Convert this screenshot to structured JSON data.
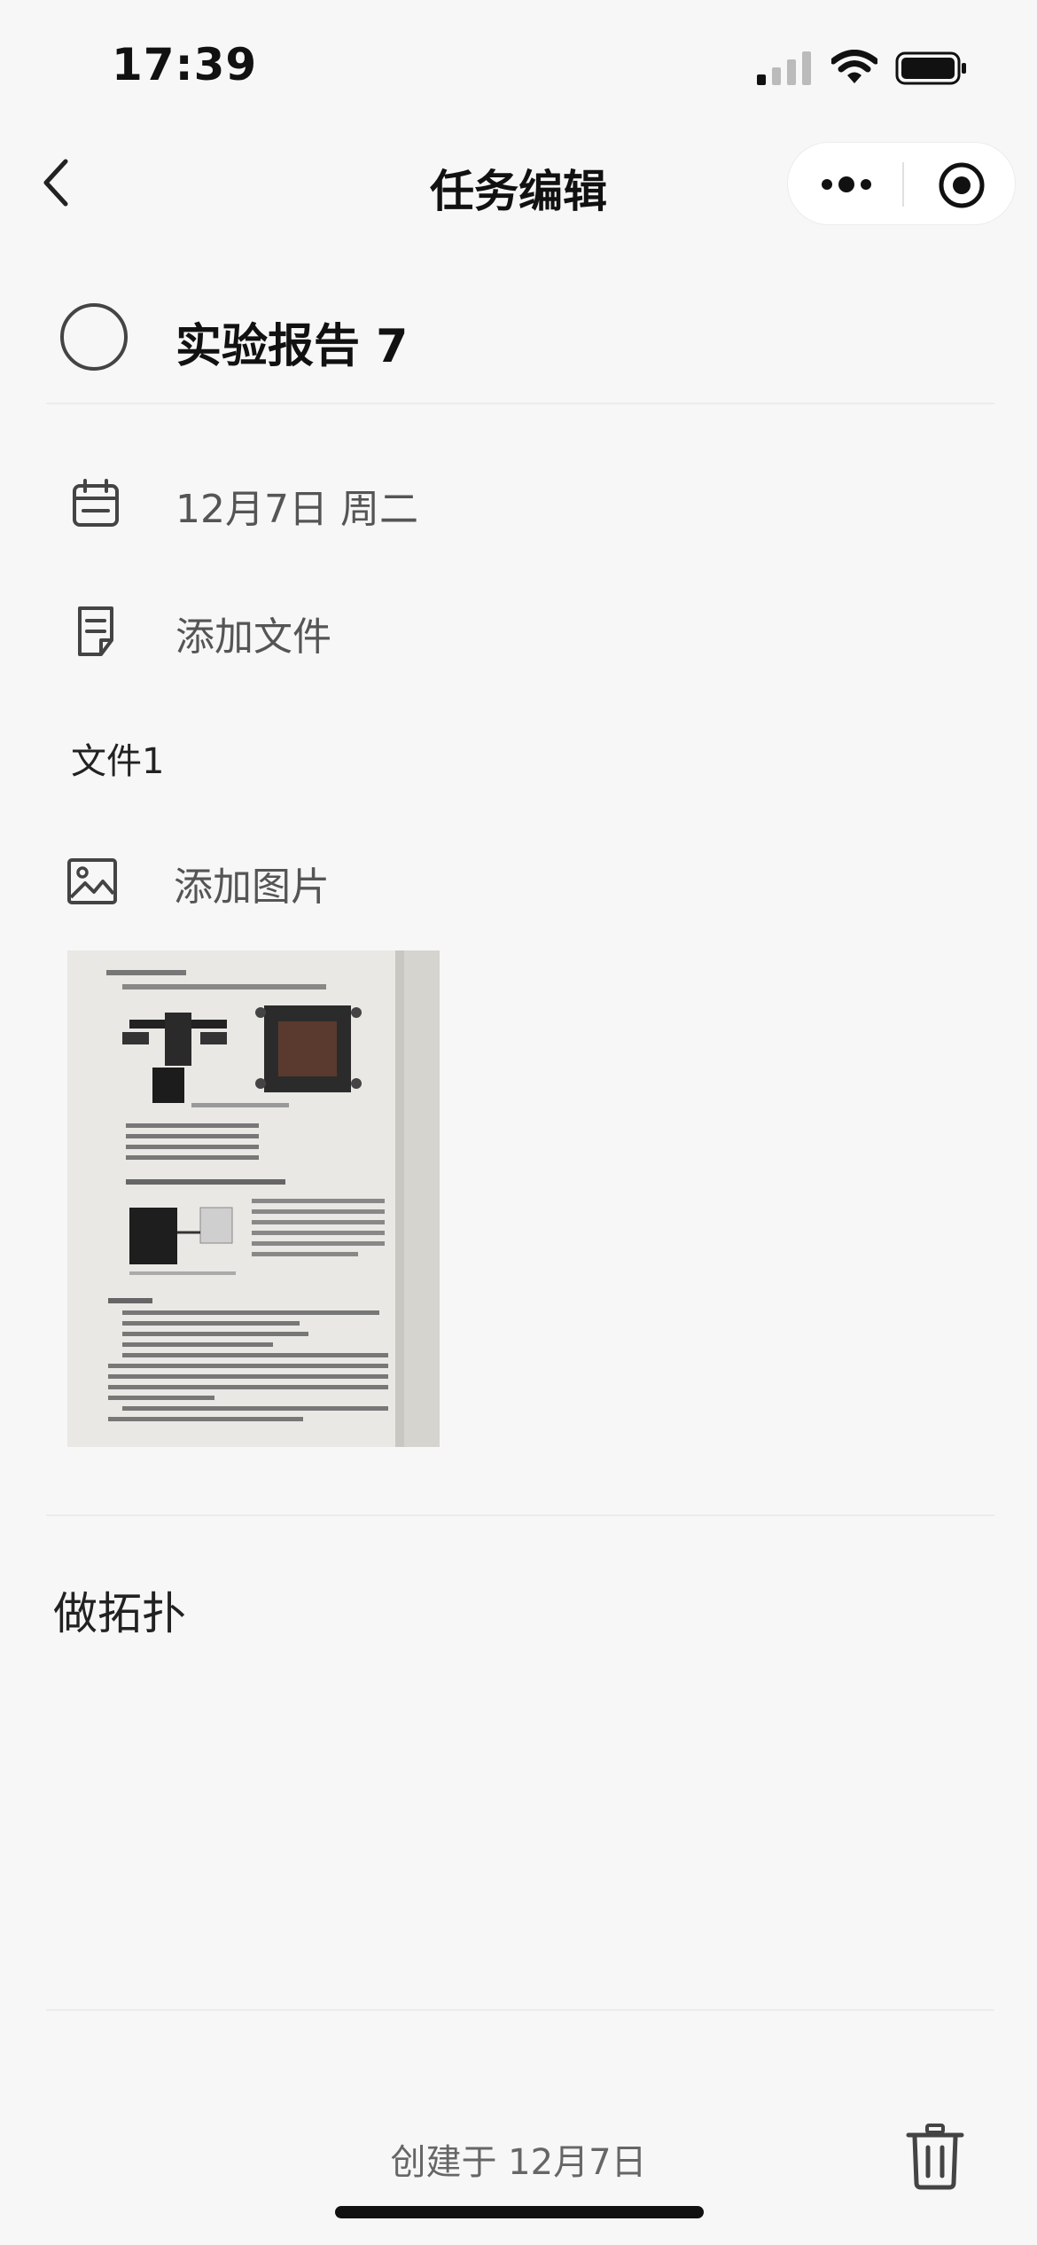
{
  "status_bar": {
    "time": "17:39"
  },
  "nav": {
    "title": "任务编辑"
  },
  "task": {
    "title": "实验报告 7"
  },
  "date_row": {
    "label": "12月7日 周二"
  },
  "file_row": {
    "label": "添加文件",
    "files": [
      "文件1"
    ]
  },
  "image_row": {
    "label": "添加图片"
  },
  "note": {
    "text": "做拓扑"
  },
  "footer": {
    "created": "创建于 12月7日"
  },
  "colors": {
    "background": "#f7f7f7",
    "icon": "#444444",
    "text_muted": "#555555"
  }
}
